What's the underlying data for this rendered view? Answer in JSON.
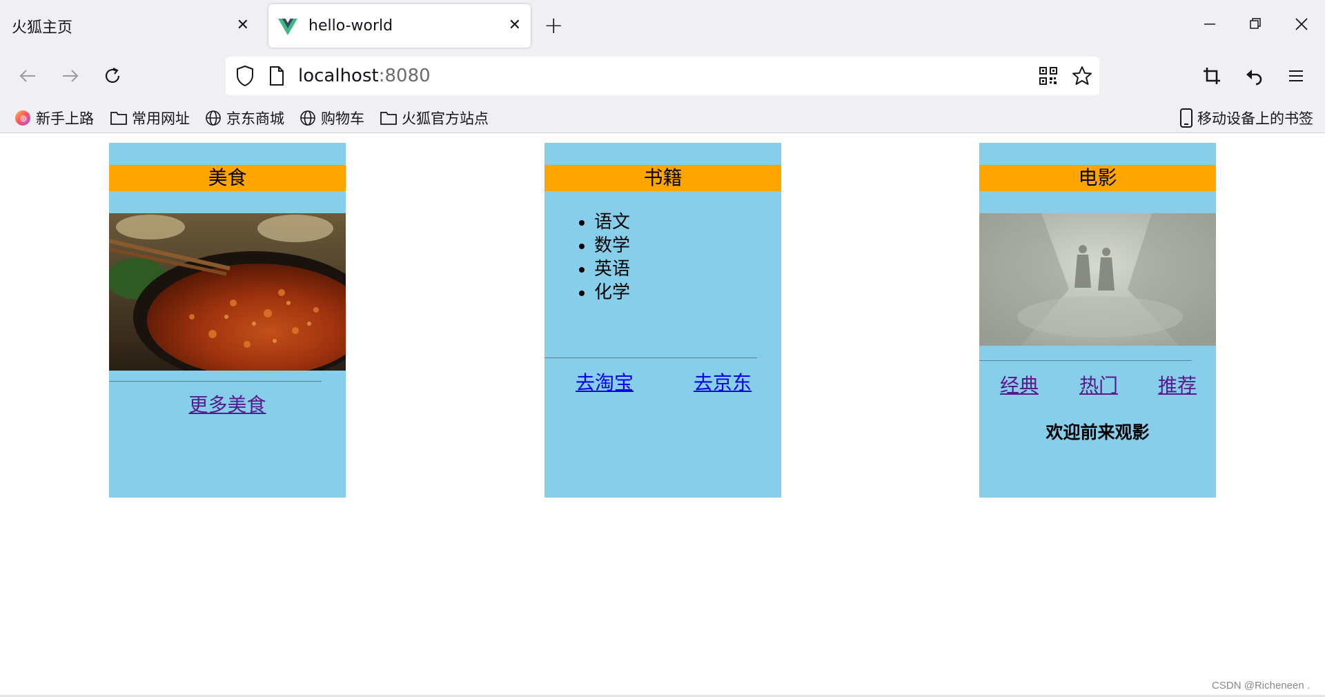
{
  "tabs": [
    {
      "title": "火狐主页",
      "active": false
    },
    {
      "title": "hello-world",
      "active": true
    }
  ],
  "url": {
    "host": "localhost",
    "port": ":8080"
  },
  "bookmarks": [
    "新手上路",
    "常用网址",
    "京东商城",
    "购物车",
    "火狐官方站点"
  ],
  "mobile_bookmarks": "移动设备上的书签",
  "cards": {
    "food": {
      "header": "美食",
      "more_link": "更多美食"
    },
    "books": {
      "header": "书籍",
      "items": [
        "语文",
        "数学",
        "英语",
        "化学"
      ],
      "link1": "去淘宝",
      "link2": "去京东"
    },
    "movies": {
      "header": "电影",
      "link1": "经典",
      "link2": "热门",
      "link3": "推荐",
      "welcome": "欢迎前来观影"
    }
  },
  "dashes": "____________________________",
  "watermark": "CSDN @Richeneen .",
  "colors": {
    "card_bg": "#87ceeb",
    "header_bg": "#ffa500",
    "chrome_bg": "#f0f0f4"
  }
}
